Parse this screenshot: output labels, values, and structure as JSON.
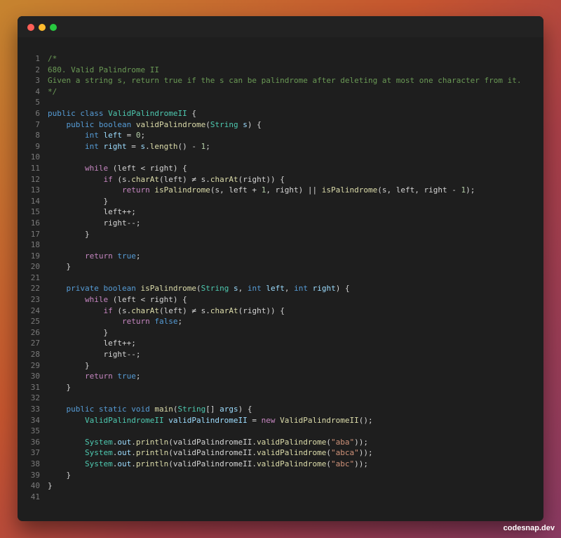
{
  "window": {
    "controls": [
      "close",
      "minimize",
      "maximize"
    ]
  },
  "code": {
    "lines": [
      [
        [
          "/*",
          "cm"
        ]
      ],
      [
        [
          "680. Valid Palindrome II",
          "cm"
        ]
      ],
      [
        [
          "Given a string s, return true if the s can be palindrome after deleting at most one character from it.",
          "cm"
        ]
      ],
      [
        [
          "*/",
          "cm"
        ]
      ],
      [],
      [
        [
          "public",
          "kw"
        ],
        [
          " ",
          "pl"
        ],
        [
          "class",
          "kw"
        ],
        [
          " ",
          "pl"
        ],
        [
          "ValidPalindromeII",
          "ty"
        ],
        [
          " {",
          "pl"
        ]
      ],
      [
        [
          "    ",
          "pl"
        ],
        [
          "public",
          "kw"
        ],
        [
          " ",
          "pl"
        ],
        [
          "boolean",
          "kw"
        ],
        [
          " ",
          "pl"
        ],
        [
          "validPalindrome",
          "fn"
        ],
        [
          "(",
          "pl"
        ],
        [
          "String",
          "ty"
        ],
        [
          " ",
          "pl"
        ],
        [
          "s",
          "vr"
        ],
        [
          ") {",
          "pl"
        ]
      ],
      [
        [
          "        ",
          "pl"
        ],
        [
          "int",
          "kw"
        ],
        [
          " ",
          "pl"
        ],
        [
          "left",
          "vr"
        ],
        [
          " = ",
          "pl"
        ],
        [
          "0",
          "nm"
        ],
        [
          ";",
          "pl"
        ]
      ],
      [
        [
          "        ",
          "pl"
        ],
        [
          "int",
          "kw"
        ],
        [
          " ",
          "pl"
        ],
        [
          "right",
          "vr"
        ],
        [
          " = ",
          "pl"
        ],
        [
          "s",
          "vr"
        ],
        [
          ".",
          "pl"
        ],
        [
          "length",
          "fn"
        ],
        [
          "() - ",
          "pl"
        ],
        [
          "1",
          "nm"
        ],
        [
          ";",
          "pl"
        ]
      ],
      [],
      [
        [
          "        ",
          "pl"
        ],
        [
          "while",
          "kw2"
        ],
        [
          " (left < right) {",
          "pl"
        ]
      ],
      [
        [
          "            ",
          "pl"
        ],
        [
          "if",
          "kw2"
        ],
        [
          " (s.",
          "pl"
        ],
        [
          "charAt",
          "fn"
        ],
        [
          "(left) ≠ s.",
          "pl"
        ],
        [
          "charAt",
          "fn"
        ],
        [
          "(right)) {",
          "pl"
        ]
      ],
      [
        [
          "                ",
          "pl"
        ],
        [
          "return",
          "kw2"
        ],
        [
          " ",
          "pl"
        ],
        [
          "isPalindrome",
          "fn"
        ],
        [
          "(s, left + ",
          "pl"
        ],
        [
          "1",
          "nm"
        ],
        [
          ", right) || ",
          "pl"
        ],
        [
          "isPalindrome",
          "fn"
        ],
        [
          "(s, left, right - ",
          "pl"
        ],
        [
          "1",
          "nm"
        ],
        [
          ");",
          "pl"
        ]
      ],
      [
        [
          "            }",
          "pl"
        ]
      ],
      [
        [
          "            left++;",
          "pl"
        ]
      ],
      [
        [
          "            right--;",
          "pl"
        ]
      ],
      [
        [
          "        }",
          "pl"
        ]
      ],
      [],
      [
        [
          "        ",
          "pl"
        ],
        [
          "return",
          "kw2"
        ],
        [
          " ",
          "pl"
        ],
        [
          "true",
          "kw"
        ],
        [
          ";",
          "pl"
        ]
      ],
      [
        [
          "    }",
          "pl"
        ]
      ],
      [],
      [
        [
          "    ",
          "pl"
        ],
        [
          "private",
          "kw"
        ],
        [
          " ",
          "pl"
        ],
        [
          "boolean",
          "kw"
        ],
        [
          " ",
          "pl"
        ],
        [
          "isPalindrome",
          "fn"
        ],
        [
          "(",
          "pl"
        ],
        [
          "String",
          "ty"
        ],
        [
          " ",
          "pl"
        ],
        [
          "s",
          "vr"
        ],
        [
          ", ",
          "pl"
        ],
        [
          "int",
          "kw"
        ],
        [
          " ",
          "pl"
        ],
        [
          "left",
          "vr"
        ],
        [
          ", ",
          "pl"
        ],
        [
          "int",
          "kw"
        ],
        [
          " ",
          "pl"
        ],
        [
          "right",
          "vr"
        ],
        [
          ") {",
          "pl"
        ]
      ],
      [
        [
          "        ",
          "pl"
        ],
        [
          "while",
          "kw2"
        ],
        [
          " (left < right) {",
          "pl"
        ]
      ],
      [
        [
          "            ",
          "pl"
        ],
        [
          "if",
          "kw2"
        ],
        [
          " (s.",
          "pl"
        ],
        [
          "charAt",
          "fn"
        ],
        [
          "(left) ≠ s.",
          "pl"
        ],
        [
          "charAt",
          "fn"
        ],
        [
          "(right)) {",
          "pl"
        ]
      ],
      [
        [
          "                ",
          "pl"
        ],
        [
          "return",
          "kw2"
        ],
        [
          " ",
          "pl"
        ],
        [
          "false",
          "kw"
        ],
        [
          ";",
          "pl"
        ]
      ],
      [
        [
          "            }",
          "pl"
        ]
      ],
      [
        [
          "            left++;",
          "pl"
        ]
      ],
      [
        [
          "            right--;",
          "pl"
        ]
      ],
      [
        [
          "        }",
          "pl"
        ]
      ],
      [
        [
          "        ",
          "pl"
        ],
        [
          "return",
          "kw2"
        ],
        [
          " ",
          "pl"
        ],
        [
          "true",
          "kw"
        ],
        [
          ";",
          "pl"
        ]
      ],
      [
        [
          "    }",
          "pl"
        ]
      ],
      [],
      [
        [
          "    ",
          "pl"
        ],
        [
          "public",
          "kw"
        ],
        [
          " ",
          "pl"
        ],
        [
          "static",
          "kw"
        ],
        [
          " ",
          "pl"
        ],
        [
          "void",
          "kw"
        ],
        [
          " ",
          "pl"
        ],
        [
          "main",
          "fn"
        ],
        [
          "(",
          "pl"
        ],
        [
          "String",
          "ty"
        ],
        [
          "[] ",
          "pl"
        ],
        [
          "args",
          "vr"
        ],
        [
          ") {",
          "pl"
        ]
      ],
      [
        [
          "        ",
          "pl"
        ],
        [
          "ValidPalindromeII",
          "ty"
        ],
        [
          " ",
          "pl"
        ],
        [
          "validPalindromeII",
          "vr"
        ],
        [
          " = ",
          "pl"
        ],
        [
          "new",
          "kw2"
        ],
        [
          " ",
          "pl"
        ],
        [
          "ValidPalindromeII",
          "fn"
        ],
        [
          "();",
          "pl"
        ]
      ],
      [],
      [
        [
          "        ",
          "pl"
        ],
        [
          "System",
          "ty"
        ],
        [
          ".",
          "pl"
        ],
        [
          "out",
          "vr"
        ],
        [
          ".",
          "pl"
        ],
        [
          "println",
          "fn"
        ],
        [
          "(validPalindromeII.",
          "pl"
        ],
        [
          "validPalindrome",
          "fn"
        ],
        [
          "(",
          "pl"
        ],
        [
          "\"aba\"",
          "st"
        ],
        [
          "));",
          "pl"
        ]
      ],
      [
        [
          "        ",
          "pl"
        ],
        [
          "System",
          "ty"
        ],
        [
          ".",
          "pl"
        ],
        [
          "out",
          "vr"
        ],
        [
          ".",
          "pl"
        ],
        [
          "println",
          "fn"
        ],
        [
          "(validPalindromeII.",
          "pl"
        ],
        [
          "validPalindrome",
          "fn"
        ],
        [
          "(",
          "pl"
        ],
        [
          "\"abca\"",
          "st"
        ],
        [
          "));",
          "pl"
        ]
      ],
      [
        [
          "        ",
          "pl"
        ],
        [
          "System",
          "ty"
        ],
        [
          ".",
          "pl"
        ],
        [
          "out",
          "vr"
        ],
        [
          ".",
          "pl"
        ],
        [
          "println",
          "fn"
        ],
        [
          "(validPalindromeII.",
          "pl"
        ],
        [
          "validPalindrome",
          "fn"
        ],
        [
          "(",
          "pl"
        ],
        [
          "\"abc\"",
          "st"
        ],
        [
          "));",
          "pl"
        ]
      ],
      [
        [
          "    }",
          "pl"
        ]
      ],
      [
        [
          "}",
          "pl"
        ]
      ],
      []
    ]
  },
  "footer": {
    "brand": "codesnap.dev"
  }
}
